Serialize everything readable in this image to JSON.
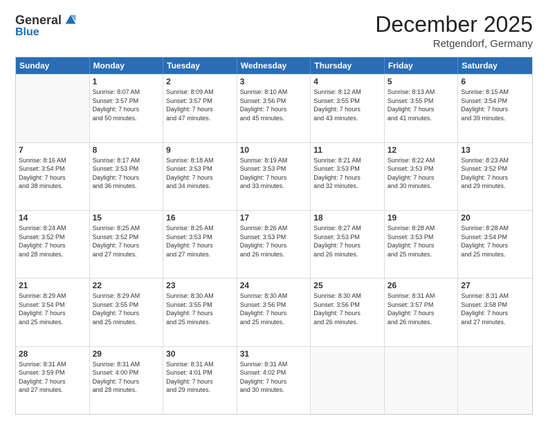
{
  "logo": {
    "general": "General",
    "blue": "Blue"
  },
  "header": {
    "month": "December 2025",
    "location": "Retgendorf, Germany"
  },
  "days": [
    "Sunday",
    "Monday",
    "Tuesday",
    "Wednesday",
    "Thursday",
    "Friday",
    "Saturday"
  ],
  "rows": [
    [
      {
        "day": "",
        "empty": true
      },
      {
        "day": "1",
        "sunrise": "8:07 AM",
        "sunset": "3:57 PM",
        "daylight": "7 hours and 50 minutes."
      },
      {
        "day": "2",
        "sunrise": "8:09 AM",
        "sunset": "3:57 PM",
        "daylight": "7 hours and 47 minutes."
      },
      {
        "day": "3",
        "sunrise": "8:10 AM",
        "sunset": "3:56 PM",
        "daylight": "7 hours and 45 minutes."
      },
      {
        "day": "4",
        "sunrise": "8:12 AM",
        "sunset": "3:55 PM",
        "daylight": "7 hours and 43 minutes."
      },
      {
        "day": "5",
        "sunrise": "8:13 AM",
        "sunset": "3:55 PM",
        "daylight": "7 hours and 41 minutes."
      },
      {
        "day": "6",
        "sunrise": "8:15 AM",
        "sunset": "3:54 PM",
        "daylight": "7 hours and 39 minutes."
      }
    ],
    [
      {
        "day": "7",
        "sunrise": "8:16 AM",
        "sunset": "3:54 PM",
        "daylight": "7 hours and 38 minutes."
      },
      {
        "day": "8",
        "sunrise": "8:17 AM",
        "sunset": "3:53 PM",
        "daylight": "7 hours and 36 minutes."
      },
      {
        "day": "9",
        "sunrise": "8:18 AM",
        "sunset": "3:53 PM",
        "daylight": "7 hours and 34 minutes."
      },
      {
        "day": "10",
        "sunrise": "8:19 AM",
        "sunset": "3:53 PM",
        "daylight": "7 hours and 33 minutes."
      },
      {
        "day": "11",
        "sunrise": "8:21 AM",
        "sunset": "3:53 PM",
        "daylight": "7 hours and 32 minutes."
      },
      {
        "day": "12",
        "sunrise": "8:22 AM",
        "sunset": "3:53 PM",
        "daylight": "7 hours and 30 minutes."
      },
      {
        "day": "13",
        "sunrise": "8:23 AM",
        "sunset": "3:52 PM",
        "daylight": "7 hours and 29 minutes."
      }
    ],
    [
      {
        "day": "14",
        "sunrise": "8:24 AM",
        "sunset": "3:52 PM",
        "daylight": "7 hours and 28 minutes."
      },
      {
        "day": "15",
        "sunrise": "8:25 AM",
        "sunset": "3:52 PM",
        "daylight": "7 hours and 27 minutes."
      },
      {
        "day": "16",
        "sunrise": "8:25 AM",
        "sunset": "3:53 PM",
        "daylight": "7 hours and 27 minutes."
      },
      {
        "day": "17",
        "sunrise": "8:26 AM",
        "sunset": "3:53 PM",
        "daylight": "7 hours and 26 minutes."
      },
      {
        "day": "18",
        "sunrise": "8:27 AM",
        "sunset": "3:53 PM",
        "daylight": "7 hours and 26 minutes."
      },
      {
        "day": "19",
        "sunrise": "8:28 AM",
        "sunset": "3:53 PM",
        "daylight": "7 hours and 25 minutes."
      },
      {
        "day": "20",
        "sunrise": "8:28 AM",
        "sunset": "3:54 PM",
        "daylight": "7 hours and 25 minutes."
      }
    ],
    [
      {
        "day": "21",
        "sunrise": "8:29 AM",
        "sunset": "3:54 PM",
        "daylight": "7 hours and 25 minutes."
      },
      {
        "day": "22",
        "sunrise": "8:29 AM",
        "sunset": "3:55 PM",
        "daylight": "7 hours and 25 minutes."
      },
      {
        "day": "23",
        "sunrise": "8:30 AM",
        "sunset": "3:55 PM",
        "daylight": "7 hours and 25 minutes."
      },
      {
        "day": "24",
        "sunrise": "8:30 AM",
        "sunset": "3:56 PM",
        "daylight": "7 hours and 25 minutes."
      },
      {
        "day": "25",
        "sunrise": "8:30 AM",
        "sunset": "3:56 PM",
        "daylight": "7 hours and 26 minutes."
      },
      {
        "day": "26",
        "sunrise": "8:31 AM",
        "sunset": "3:57 PM",
        "daylight": "7 hours and 26 minutes."
      },
      {
        "day": "27",
        "sunrise": "8:31 AM",
        "sunset": "3:58 PM",
        "daylight": "7 hours and 27 minutes."
      }
    ],
    [
      {
        "day": "28",
        "sunrise": "8:31 AM",
        "sunset": "3:59 PM",
        "daylight": "7 hours and 27 minutes."
      },
      {
        "day": "29",
        "sunrise": "8:31 AM",
        "sunset": "4:00 PM",
        "daylight": "7 hours and 28 minutes."
      },
      {
        "day": "30",
        "sunrise": "8:31 AM",
        "sunset": "4:01 PM",
        "daylight": "7 hours and 29 minutes."
      },
      {
        "day": "31",
        "sunrise": "8:31 AM",
        "sunset": "4:02 PM",
        "daylight": "7 hours and 30 minutes."
      },
      {
        "day": "",
        "empty": true
      },
      {
        "day": "",
        "empty": true
      },
      {
        "day": "",
        "empty": true
      }
    ]
  ],
  "labels": {
    "sunrise": "Sunrise:",
    "sunset": "Sunset:",
    "daylight": "Daylight:"
  }
}
